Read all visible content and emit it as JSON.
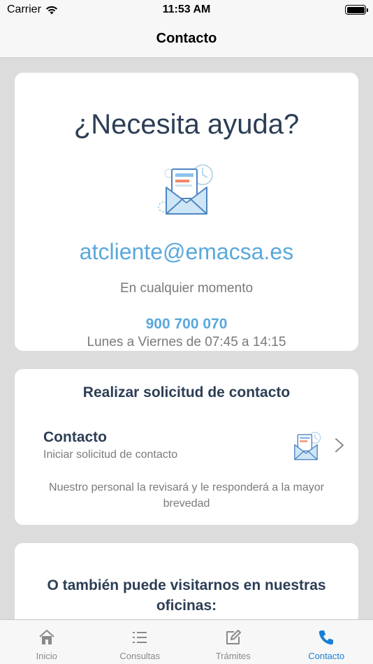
{
  "status_bar": {
    "carrier": "Carrier",
    "time": "11:53 AM",
    "battery_level": 1.0
  },
  "nav": {
    "title": "Contacto"
  },
  "help_card": {
    "title": "¿Necesita ayuda?",
    "icon": "mail-envelope-icon",
    "email": "atcliente@emacsa.es",
    "email_note": "En cualquier momento",
    "phone": "900 700 070",
    "phone_hours": "Lunes a Viernes de 07:45 a 14:15"
  },
  "request_card": {
    "title": "Realizar solicitud de contacto",
    "row_title": "Contacto",
    "row_subtitle": "Iniciar solicitud de contacto",
    "row_icon": "mail-envelope-icon",
    "note": "Nuestro personal la revisará y le responderá a la mayor brevedad"
  },
  "offices_card": {
    "title": "O también puede visitarnos en nuestras oficinas:"
  },
  "tab_bar": {
    "tabs": [
      {
        "label": "Inicio",
        "icon": "home-icon",
        "active": false
      },
      {
        "label": "Consultas",
        "icon": "list-icon",
        "active": false
      },
      {
        "label": "Trámites",
        "icon": "edit-icon",
        "active": false
      },
      {
        "label": "Contacto",
        "icon": "phone-icon",
        "active": true
      }
    ]
  },
  "colors": {
    "accent": "#1a7fd6",
    "link": "#5aa8dc",
    "heading": "#2c3e55",
    "background": "#dcdcdc"
  }
}
